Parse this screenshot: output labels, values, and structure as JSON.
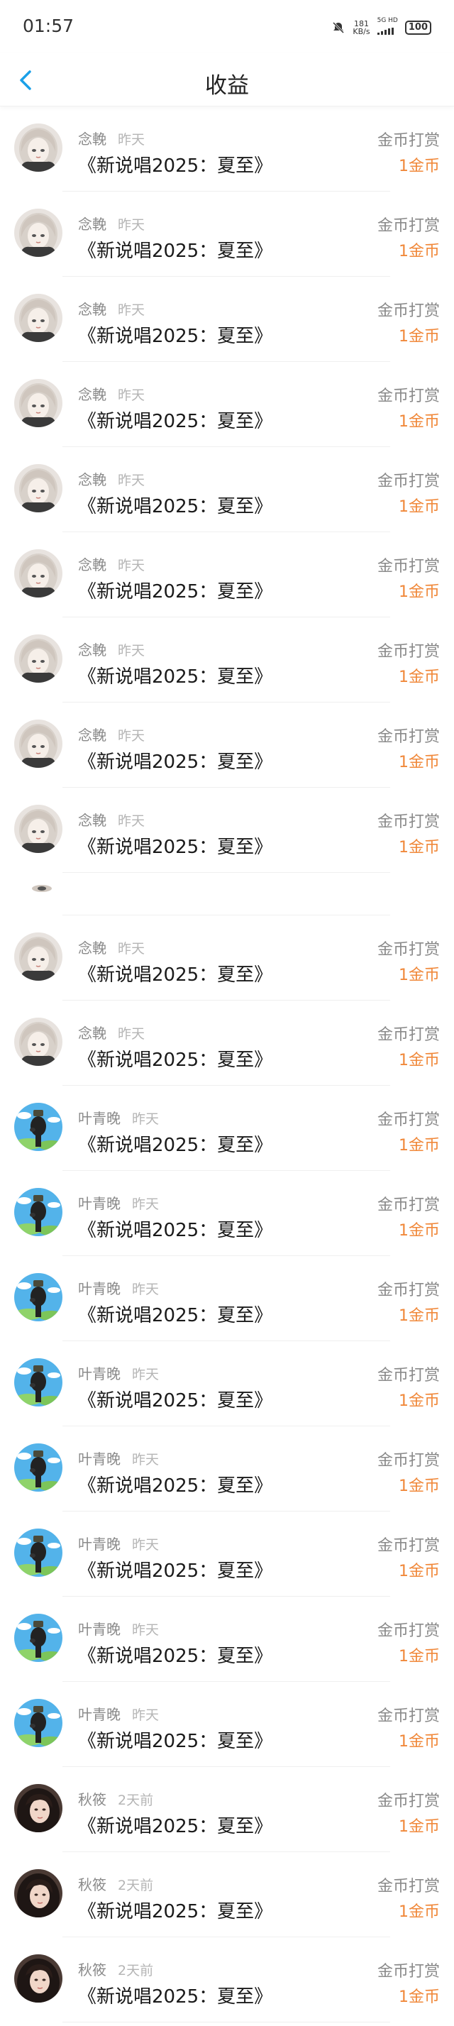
{
  "status": {
    "time": "01:57",
    "speed_top": "181",
    "speed_bottom": "KB/s",
    "network": "5G HD",
    "battery": "100"
  },
  "nav": {
    "title": "收益"
  },
  "colors": {
    "accent_blue": "#1aa0e8",
    "amount_orange": "#f0883a"
  },
  "rows": [
    {
      "avatar": "anime-girl-avatar",
      "name": "念輓",
      "time": "昨天",
      "work": "《新说唱2025：夏至》",
      "type": "金币打赏",
      "amount": "1金币"
    },
    {
      "avatar": "anime-girl-avatar",
      "name": "念輓",
      "time": "昨天",
      "work": "《新说唱2025：夏至》",
      "type": "金币打赏",
      "amount": "1金币"
    },
    {
      "avatar": "anime-girl-avatar",
      "name": "念輓",
      "time": "昨天",
      "work": "《新说唱2025：夏至》",
      "type": "金币打赏",
      "amount": "1金币"
    },
    {
      "avatar": "anime-girl-avatar",
      "name": "念輓",
      "time": "昨天",
      "work": "《新说唱2025：夏至》",
      "type": "金币打赏",
      "amount": "1金币"
    },
    {
      "avatar": "anime-girl-avatar",
      "name": "念輓",
      "time": "昨天",
      "work": "《新说唱2025：夏至》",
      "type": "金币打赏",
      "amount": "1金币"
    },
    {
      "avatar": "anime-girl-avatar",
      "name": "念輓",
      "time": "昨天",
      "work": "《新说唱2025：夏至》",
      "type": "金币打赏",
      "amount": "1金币"
    },
    {
      "avatar": "anime-girl-avatar",
      "name": "念輓",
      "time": "昨天",
      "work": "《新说唱2025：夏至》",
      "type": "金币打赏",
      "amount": "1金币"
    },
    {
      "avatar": "anime-girl-avatar",
      "name": "念輓",
      "time": "昨天",
      "work": "《新说唱2025：夏至》",
      "type": "金币打赏",
      "amount": "1金币"
    },
    {
      "avatar": "anime-girl-avatar",
      "name": "念輓",
      "time": "昨天",
      "work": "《新说唱2025：夏至》",
      "type": "金币打赏",
      "amount": "1金币"
    },
    {
      "placeholder": true
    },
    {
      "avatar": "anime-girl-avatar",
      "name": "念輓",
      "time": "昨天",
      "work": "《新说唱2025：夏至》",
      "type": "金币打赏",
      "amount": "1金币"
    },
    {
      "avatar": "anime-girl-avatar",
      "name": "念輓",
      "time": "昨天",
      "work": "《新说唱2025：夏至》",
      "type": "金币打赏",
      "amount": "1金币"
    },
    {
      "avatar": "sky-figure-avatar",
      "name": "叶青晚",
      "time": "昨天",
      "work": "《新说唱2025：夏至》",
      "type": "金币打赏",
      "amount": "1金币"
    },
    {
      "avatar": "sky-figure-avatar",
      "name": "叶青晚",
      "time": "昨天",
      "work": "《新说唱2025：夏至》",
      "type": "金币打赏",
      "amount": "1金币"
    },
    {
      "avatar": "sky-figure-avatar",
      "name": "叶青晚",
      "time": "昨天",
      "work": "《新说唱2025：夏至》",
      "type": "金币打赏",
      "amount": "1金币"
    },
    {
      "avatar": "sky-figure-avatar",
      "name": "叶青晚",
      "time": "昨天",
      "work": "《新说唱2025：夏至》",
      "type": "金币打赏",
      "amount": "1金币"
    },
    {
      "avatar": "sky-figure-avatar",
      "name": "叶青晚",
      "time": "昨天",
      "work": "《新说唱2025：夏至》",
      "type": "金币打赏",
      "amount": "1金币"
    },
    {
      "avatar": "sky-figure-avatar",
      "name": "叶青晚",
      "time": "昨天",
      "work": "《新说唱2025：夏至》",
      "type": "金币打赏",
      "amount": "1金币"
    },
    {
      "avatar": "sky-figure-avatar",
      "name": "叶青晚",
      "time": "昨天",
      "work": "《新说唱2025：夏至》",
      "type": "金币打赏",
      "amount": "1金币"
    },
    {
      "avatar": "sky-figure-avatar",
      "name": "叶青晚",
      "time": "昨天",
      "work": "《新说唱2025：夏至》",
      "type": "金币打赏",
      "amount": "1金币"
    },
    {
      "avatar": "photo-girl-avatar",
      "name": "秋筱",
      "time": "2天前",
      "work": "《新说唱2025：夏至》",
      "type": "金币打赏",
      "amount": "1金币"
    },
    {
      "avatar": "photo-girl-avatar",
      "name": "秋筱",
      "time": "2天前",
      "work": "《新说唱2025：夏至》",
      "type": "金币打赏",
      "amount": "1金币"
    },
    {
      "avatar": "photo-girl-avatar",
      "name": "秋筱",
      "time": "2天前",
      "work": "《新说唱2025：夏至》",
      "type": "金币打赏",
      "amount": "1金币"
    }
  ]
}
